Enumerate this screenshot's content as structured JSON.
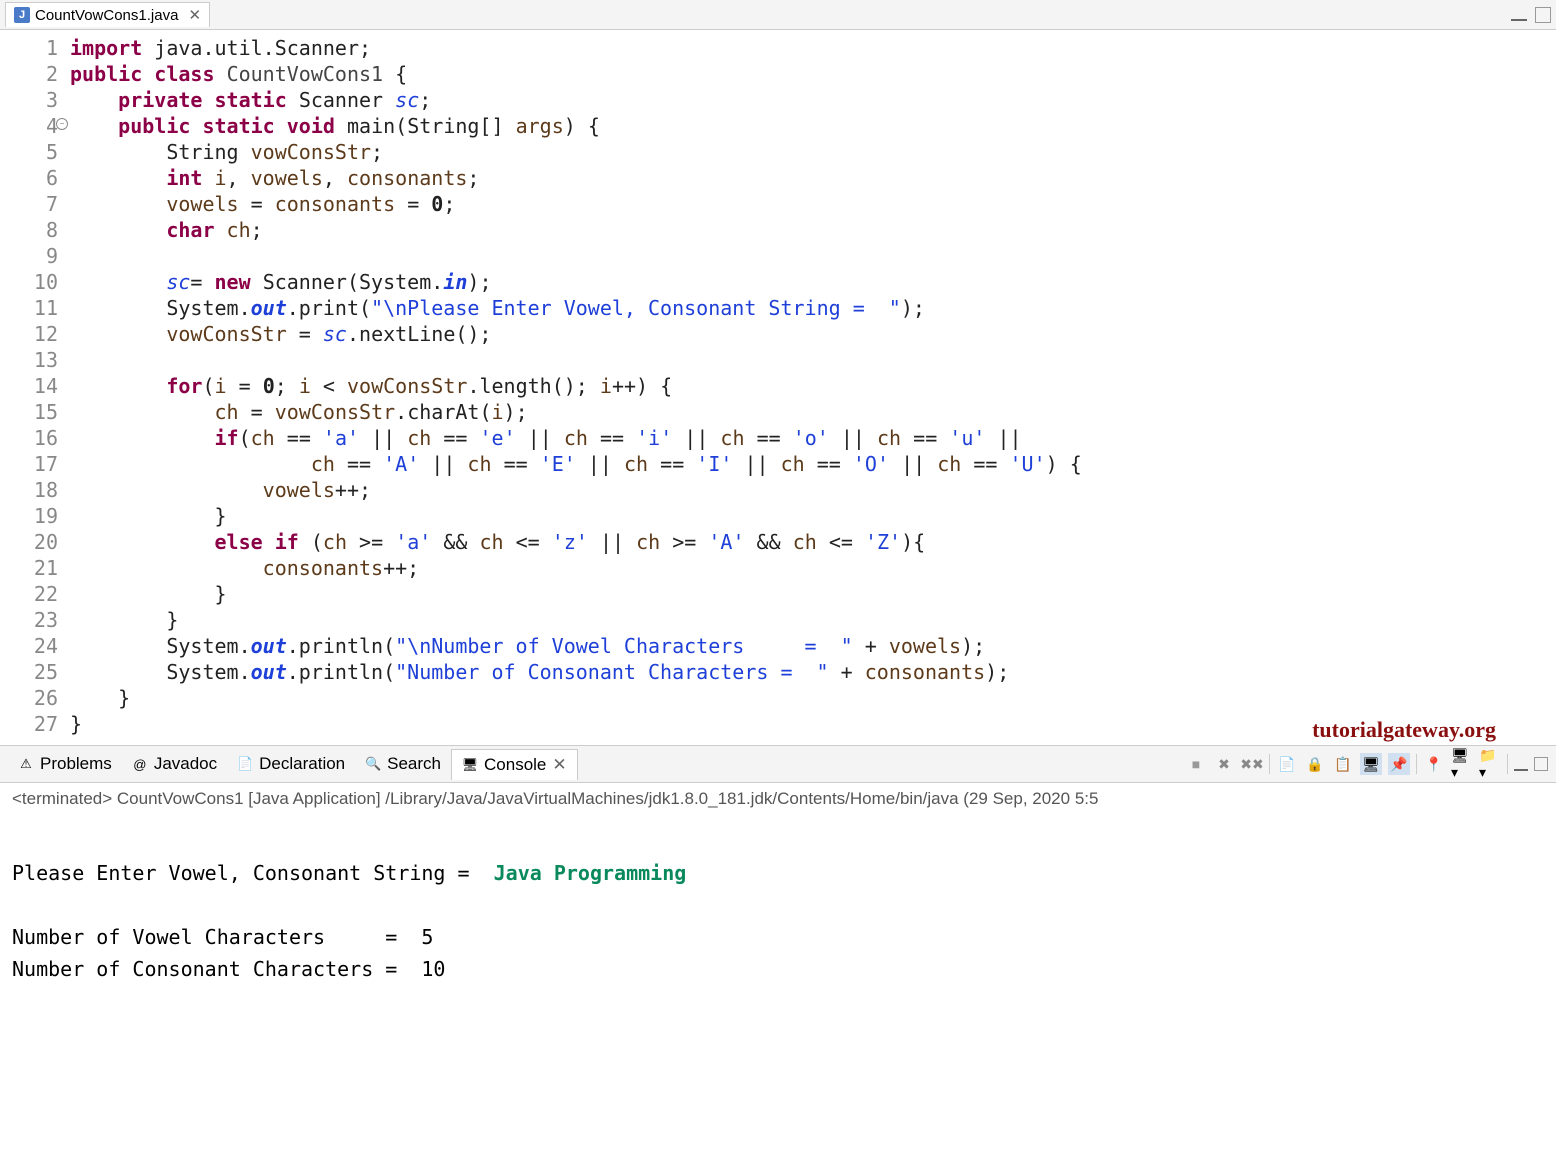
{
  "tab": {
    "filename": "CountVowCons1.java",
    "icon_letter": "J"
  },
  "code": {
    "lines": [
      {
        "n": 1,
        "html": "<span class='kw'>import</span> <span class='plain'>java.util.Scanner;</span>"
      },
      {
        "n": 2,
        "html": "<span class='kw'>public</span> <span class='kw'>class</span> <span class='cls'>CountVowCons1</span> <span class='pun'>{</span>"
      },
      {
        "n": 3,
        "html": "    <span class='kw'>private</span> <span class='kw'>static</span> <span class='plain'>Scanner</span> <span class='fld'>sc</span><span class='pun'>;</span>"
      },
      {
        "n": 4,
        "html": "    <span class='kw'>public</span> <span class='kw'>static</span> <span class='kw'>void</span> <span class='plain'>main(String[]</span> <span class='var'>args</span><span class='pun'>) {</span>",
        "fold": true
      },
      {
        "n": 5,
        "html": "        <span class='plain'>String</span> <span class='var'>vowConsStr</span><span class='pun'>;</span>"
      },
      {
        "n": 6,
        "html": "        <span class='kw'>int</span> <span class='var'>i</span><span class='pun'>,</span> <span class='var'>vowels</span><span class='pun'>,</span> <span class='var'>consonants</span><span class='pun'>;</span>"
      },
      {
        "n": 7,
        "html": "        <span class='var'>vowels</span> <span class='pun'>=</span> <span class='var'>consonants</span> <span class='pun'>=</span> <span class='num'>0</span><span class='pun'>;</span>"
      },
      {
        "n": 8,
        "html": "        <span class='kw'>char</span> <span class='var'>ch</span><span class='pun'>;</span>"
      },
      {
        "n": 9,
        "html": ""
      },
      {
        "n": 10,
        "html": "        <span class='fld'>sc</span><span class='pun'>=</span> <span class='kw'>new</span> <span class='plain'>Scanner(System.</span><span class='fldb'>in</span><span class='pun'>);</span>"
      },
      {
        "n": 11,
        "html": "        <span class='plain'>System.</span><span class='fldb'>out</span><span class='plain'>.print(</span><span class='str'>\"\\nPlease Enter Vowel, Consonant String =  \"</span><span class='pun'>);</span>"
      },
      {
        "n": 12,
        "html": "        <span class='var'>vowConsStr</span> <span class='pun'>=</span> <span class='fld'>sc</span><span class='plain'>.nextLine();</span>"
      },
      {
        "n": 13,
        "html": ""
      },
      {
        "n": 14,
        "html": "        <span class='kw'>for</span><span class='pun'>(</span><span class='var'>i</span> <span class='pun'>=</span> <span class='num'>0</span><span class='pun'>;</span> <span class='var'>i</span> <span class='pun'>&lt;</span> <span class='var'>vowConsStr</span><span class='plain'>.length();</span> <span class='var'>i</span><span class='pun'>++) {</span>"
      },
      {
        "n": 15,
        "html": "            <span class='var'>ch</span> <span class='pun'>=</span> <span class='var'>vowConsStr</span><span class='plain'>.charAt(</span><span class='var'>i</span><span class='pun'>);</span>"
      },
      {
        "n": 16,
        "html": "            <span class='kw'>if</span><span class='pun'>(</span><span class='var'>ch</span> <span class='pun'>==</span> <span class='str'>'a'</span> <span class='pun'>||</span> <span class='var'>ch</span> <span class='pun'>==</span> <span class='str'>'e'</span> <span class='pun'>||</span> <span class='var'>ch</span> <span class='pun'>==</span> <span class='str'>'i'</span> <span class='pun'>||</span> <span class='var'>ch</span> <span class='pun'>==</span> <span class='str'>'o'</span> <span class='pun'>||</span> <span class='var'>ch</span> <span class='pun'>==</span> <span class='str'>'u'</span> <span class='pun'>||</span>"
      },
      {
        "n": 17,
        "html": "                    <span class='var'>ch</span> <span class='pun'>==</span> <span class='str'>'A'</span> <span class='pun'>||</span> <span class='var'>ch</span> <span class='pun'>==</span> <span class='str'>'E'</span> <span class='pun'>||</span> <span class='var'>ch</span> <span class='pun'>==</span> <span class='str'>'I'</span> <span class='pun'>||</span> <span class='var'>ch</span> <span class='pun'>==</span> <span class='str'>'O'</span> <span class='pun'>||</span> <span class='var'>ch</span> <span class='pun'>==</span> <span class='str'>'U'</span><span class='pun'>) {</span>"
      },
      {
        "n": 18,
        "html": "                <span class='var'>vowels</span><span class='pun'>++;</span>"
      },
      {
        "n": 19,
        "html": "            <span class='pun'>}</span>"
      },
      {
        "n": 20,
        "html": "            <span class='kw'>else</span> <span class='kw'>if</span> <span class='pun'>(</span><span class='var'>ch</span> <span class='pun'>&gt;=</span> <span class='str'>'a'</span> <span class='pun'>&amp;&amp;</span> <span class='var'>ch</span> <span class='pun'>&lt;=</span> <span class='str'>'z'</span> <span class='pun'>||</span> <span class='var'>ch</span> <span class='pun'>&gt;=</span> <span class='str'>'A'</span> <span class='pun'>&amp;&amp;</span> <span class='var'>ch</span> <span class='pun'>&lt;=</span> <span class='str'>'Z'</span><span class='pun'>){</span>"
      },
      {
        "n": 21,
        "html": "                <span class='var'>consonants</span><span class='pun'>++;</span>"
      },
      {
        "n": 22,
        "html": "            <span class='pun'>}</span>"
      },
      {
        "n": 23,
        "html": "        <span class='pun'>}</span>"
      },
      {
        "n": 24,
        "html": "        <span class='plain'>System.</span><span class='fldb'>out</span><span class='plain'>.println(</span><span class='str'>\"\\nNumber of Vowel Characters     =  \"</span> <span class='pun'>+</span> <span class='var'>vowels</span><span class='pun'>);</span>"
      },
      {
        "n": 25,
        "html": "        <span class='plain'>System.</span><span class='fldb'>out</span><span class='plain'>.println(</span><span class='str'>\"Number of Consonant Characters =  \"</span> <span class='pun'>+</span> <span class='var'>consonants</span><span class='pun'>);</span>"
      },
      {
        "n": 26,
        "html": "    <span class='pun'>}</span>"
      },
      {
        "n": 27,
        "html": "<span class='pun'>}</span>"
      }
    ]
  },
  "watermark": "tutorialgateway.org",
  "viewTabs": {
    "items": [
      {
        "label": "Problems",
        "icon": "⚠"
      },
      {
        "label": "Javadoc",
        "icon": "@"
      },
      {
        "label": "Declaration",
        "icon": "📄"
      },
      {
        "label": "Search",
        "icon": "🔍"
      },
      {
        "label": "Console",
        "icon": "🖥",
        "active": true,
        "closable": true
      }
    ]
  },
  "console": {
    "status": "<terminated> CountVowCons1 [Java Application] /Library/Java/JavaVirtualMachines/jdk1.8.0_181.jdk/Contents/Home/bin/java  (29 Sep, 2020 5:5",
    "prompt": "Please Enter Vowel, Consonant String =  ",
    "input": "Java Programming",
    "line1": "Number of Vowel Characters     =  5",
    "line2": "Number of Consonant Characters =  10"
  }
}
